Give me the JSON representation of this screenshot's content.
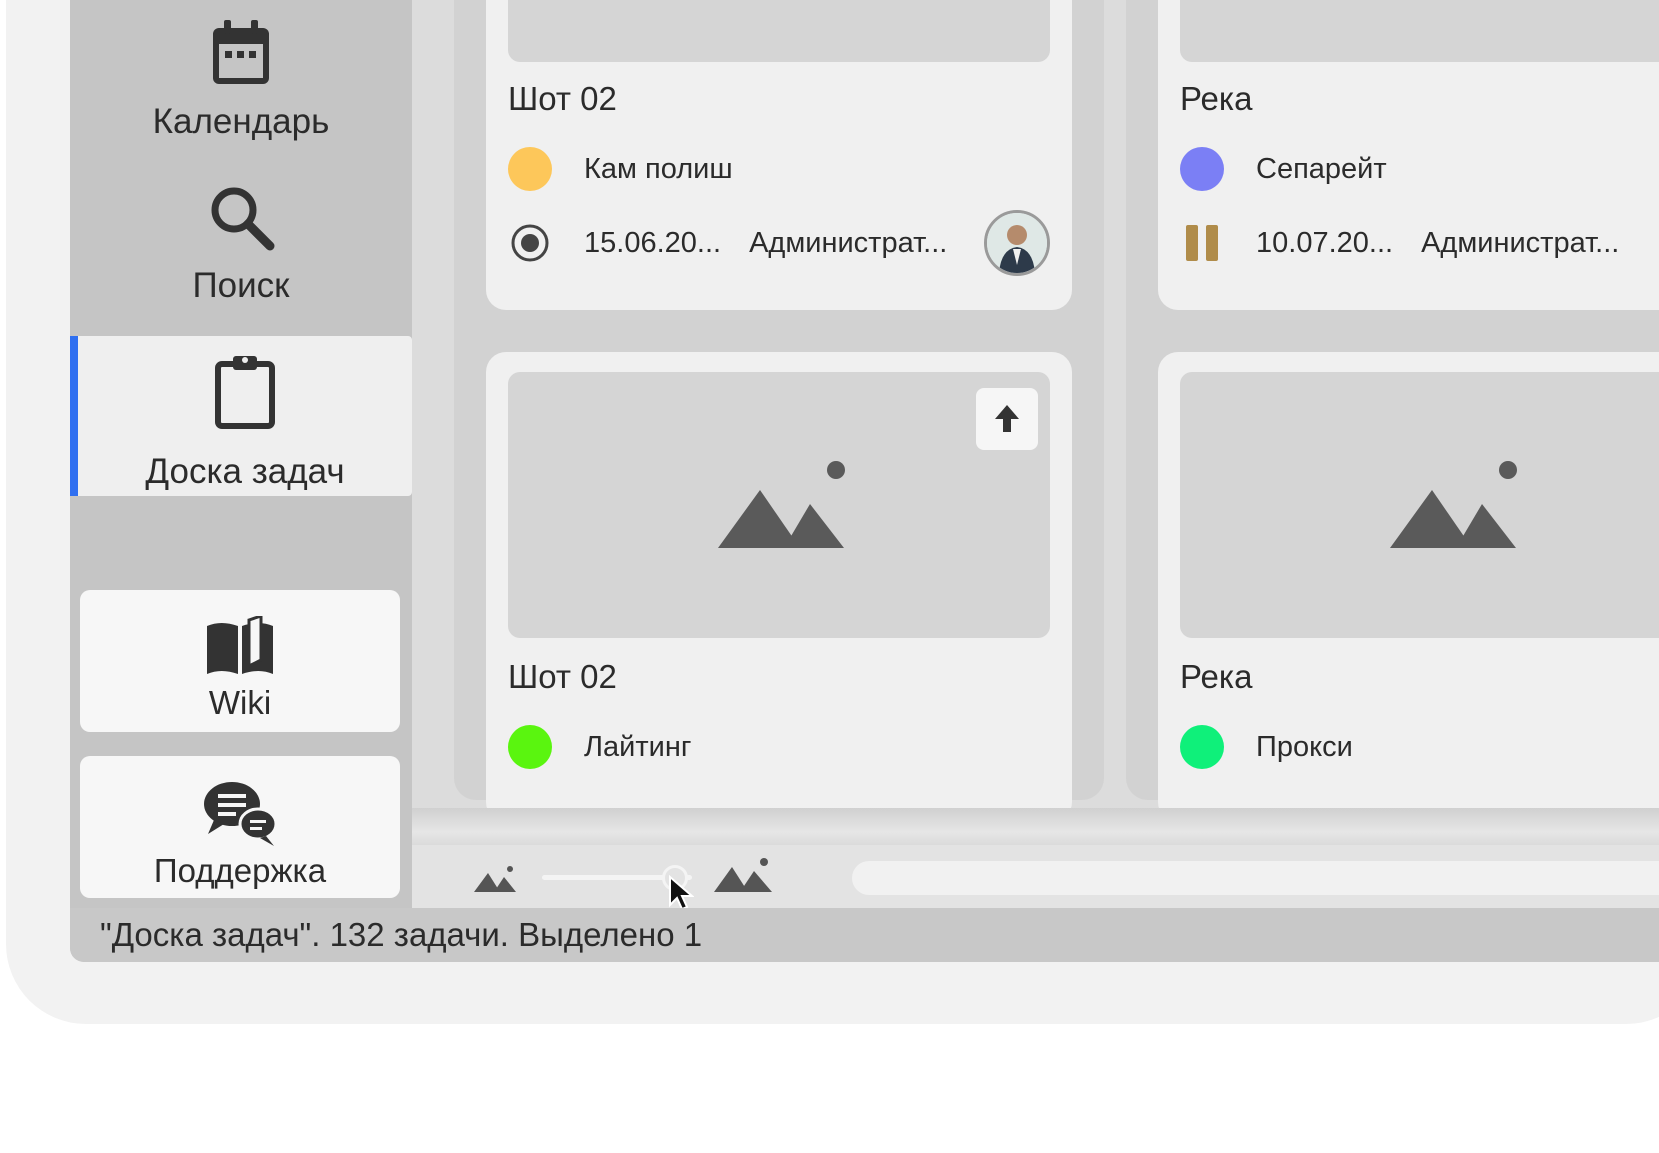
{
  "sidebar": {
    "items": [
      {
        "label": "Календарь",
        "icon": "calendar-icon"
      },
      {
        "label": "Поиск",
        "icon": "search-icon"
      },
      {
        "label": "Доска задач",
        "icon": "clipboard-icon",
        "active": true
      }
    ],
    "cards": [
      {
        "label": "Wiki",
        "icon": "book-icon"
      },
      {
        "label": "Поддержка",
        "icon": "chat-icon"
      }
    ],
    "accent_color": "#2f6ff0"
  },
  "columns": [
    {
      "cards": [
        {
          "title": "Шот 02",
          "status": "Кам полиш",
          "status_color": "#fdc75a",
          "state_icon": "radio-on-icon",
          "date": "15.06.20...",
          "user": "Администрат..."
        },
        {
          "title": "Шот 02",
          "status": "Лайтинг",
          "status_color": "#5af50f"
        }
      ]
    },
    {
      "cards": [
        {
          "title": "Река",
          "status": "Сепарейт",
          "status_color": "#7b7ff5",
          "state_icon": "pause-icon",
          "state_color": "#b08c4a",
          "date": "10.07.20...",
          "user": "Администрат..."
        },
        {
          "title": "Река",
          "status": "Прокси",
          "status_color": "#0ff07a"
        }
      ]
    }
  ],
  "zoom": {
    "level": 0.95
  },
  "status_bar": {
    "text": "\"Доска задач\". 132 задачи. Выделено 1"
  }
}
